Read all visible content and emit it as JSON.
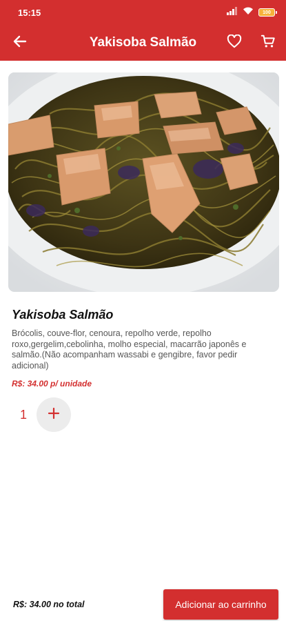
{
  "status_bar": {
    "time": "15:15",
    "battery_label": "100",
    "icons": [
      "signal-icon",
      "wifi-icon",
      "battery-icon"
    ]
  },
  "app_bar": {
    "title": "Yakisoba Salmão",
    "icons": [
      "arrow-back-icon",
      "heart-outline-icon",
      "shopping-cart-icon"
    ]
  },
  "product": {
    "image_label": "Yakisoba Salmão",
    "name": "Yakisoba Salmão",
    "description": "Brócolis, couve-flor, cenoura, repolho verde, repolho roxo,gergelim,cebolinha, molho especial, macarrão japonês  e salmão.(Não acompanham wassabi e gengibre, favor pedir adicional)",
    "price": "R$: 34.00 p/ unidade"
  },
  "quantity": {
    "value": "1",
    "plus_icon": "plus-icon"
  },
  "footer": {
    "total": "R$: 34.00 no total",
    "add_button_label": "Adicionar ao carrinho"
  },
  "colors": {
    "primary": "#d32f2f",
    "accent_battery": "#f6b13a",
    "stepper_bg": "#ececec"
  }
}
